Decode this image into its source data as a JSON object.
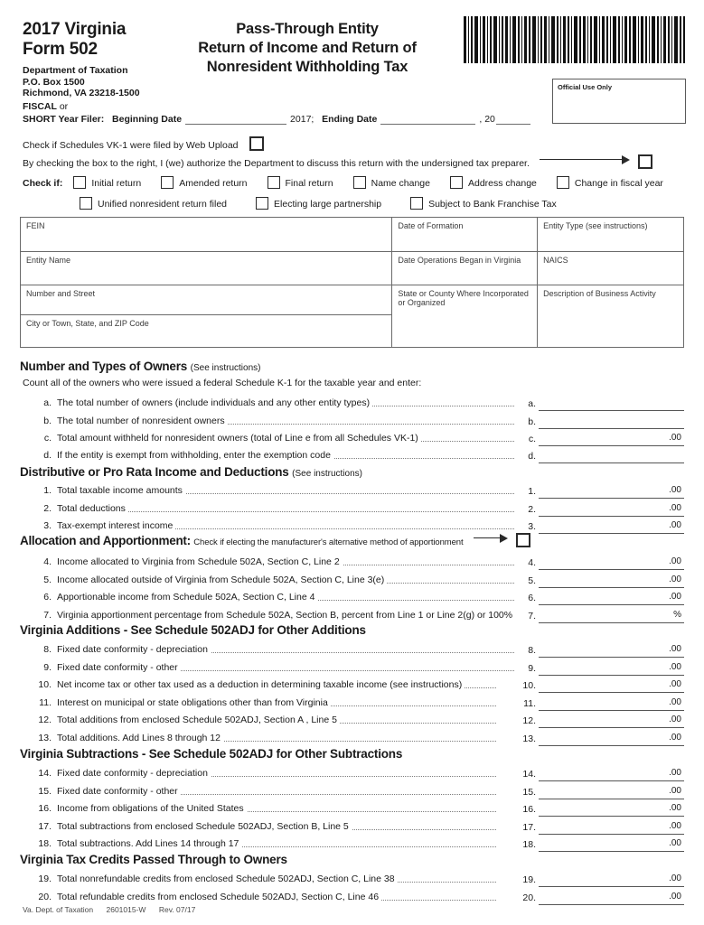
{
  "header": {
    "form_year": "2017 Virginia",
    "form_number": "Form 502",
    "dept_line1": "Department of Taxation",
    "dept_line2": "P.O. Box 1500",
    "dept_line3": "Richmond, VA 23218-1500",
    "title_line1": "Pass-Through Entity",
    "title_line2": "Return of Income and Return of",
    "title_line3": "Nonresident Withholding Tax",
    "official_use": "Official Use Only",
    "barcode_name": "barcode"
  },
  "fiscal": {
    "label_fiscal": "FISCAL",
    "label_or": " or",
    "label_short": "SHORT Year Filer:",
    "beginning_label": "Beginning Date",
    "year_mid": "2017;",
    "ending_label": "Ending Date",
    "year_suffix": ", 20"
  },
  "checks": {
    "web_upload": "Check if Schedules VK-1 were filed by Web Upload",
    "authorize": "By checking the box to the right, I (we) authorize the Department to discuss this return with the undersigned tax preparer.",
    "check_if_label": "Check if:",
    "row1": [
      "Initial return",
      "Amended return",
      "Final return",
      "Name change",
      "Address change",
      "Change in fiscal year"
    ],
    "row2": [
      "Unified nonresident return filed",
      "Electing large partnership",
      "Subject to Bank Franchise Tax"
    ]
  },
  "entity_table": {
    "rows": [
      {
        "col1": "FEIN",
        "col2": "Date of Formation",
        "col3": "Entity Type (see instructions)"
      },
      {
        "col1": "Entity Name",
        "col2": "Date Operations Began in Virginia",
        "col3": "NAICS"
      },
      {
        "col1": "Number and Street",
        "col2": "State or County Where Incorporated or Organized",
        "col3": "Description of Business Activity"
      },
      {
        "col1": "City or Town, State, and ZIP Code"
      }
    ]
  },
  "owners_section": {
    "heading": "Number and Types of Owners",
    "heading_note": "(See instructions)",
    "intro": "Count all of the owners who were issued a federal Schedule K-1 for the taxable year and enter:",
    "lines": [
      {
        "num": "a.",
        "text": "The total number of owners (include individuals and any other entity types)",
        "suffix": ""
      },
      {
        "num": "b.",
        "text": "The total number of nonresident owners",
        "suffix": ""
      },
      {
        "num": "c.",
        "text": "Total amount withheld for nonresident owners (total of Line e from all Schedules VK-1)",
        "suffix": ".00"
      },
      {
        "num": "d.",
        "text": "If the entity is exempt from withholding, enter the exemption code",
        "suffix": ""
      }
    ]
  },
  "distributive_section": {
    "heading": "Distributive or Pro Rata Income and Deductions",
    "heading_note": "(See instructions)",
    "lines": [
      {
        "num": "1.",
        "text": "Total taxable income amounts",
        "suffix": ".00"
      },
      {
        "num": "2.",
        "text": "Total deductions",
        "suffix": ".00"
      },
      {
        "num": "3.",
        "text": "Tax-exempt interest income",
        "suffix": ".00"
      }
    ]
  },
  "allocation_section": {
    "heading": "Allocation and Apportionment:",
    "checkbox_note": "Check if electing the manufacturer's alternative method of apportionment",
    "lines": [
      {
        "num": "4.",
        "text": "Income allocated to Virginia from Schedule 502A, Section C, Line 2",
        "suffix": ".00"
      },
      {
        "num": "5.",
        "text": "Income allocated outside of Virginia from Schedule 502A, Section C, Line 3(e)",
        "suffix": ".00"
      },
      {
        "num": "6.",
        "text": "Apportionable income from Schedule 502A, Section C, Line 4",
        "suffix": ".00"
      },
      {
        "num": "7.",
        "text": "Virginia apportionment percentage from Schedule 502A, Section B, percent from Line 1 or Line 2(g) or 100%",
        "suffix": "%"
      }
    ]
  },
  "additions_section": {
    "heading": "Virginia Additions - See Schedule 502ADJ for Other Additions",
    "lines": [
      {
        "num": "8.",
        "text": "Fixed date conformity - depreciation",
        "suffix": ".00"
      },
      {
        "num": "9.",
        "text": "Fixed date conformity - other",
        "suffix": ".00"
      },
      {
        "num": "10.",
        "text": "Net income tax or other tax used as a deduction in determining taxable income (see instructions)",
        "suffix": ".00"
      },
      {
        "num": "11.",
        "text": "Interest on municipal or state obligations other than from Virginia",
        "suffix": ".00"
      },
      {
        "num": "12.",
        "text": "Total additions from enclosed Schedule 502ADJ, Section A , Line 5",
        "suffix": ".00"
      },
      {
        "num": "13.",
        "text": "Total additions. Add Lines 8 through 12",
        "suffix": ".00"
      }
    ]
  },
  "subtractions_section": {
    "heading": "Virginia Subtractions - See Schedule 502ADJ for Other Subtractions",
    "lines": [
      {
        "num": "14.",
        "text": "Fixed date conformity - depreciation",
        "suffix": ".00"
      },
      {
        "num": "15.",
        "text": "Fixed date conformity - other",
        "suffix": ".00"
      },
      {
        "num": "16.",
        "text": "Income from obligations of the United States",
        "suffix": ".00"
      },
      {
        "num": "17.",
        "text": "Total subtractions from enclosed Schedule 502ADJ, Section B, Line 5",
        "suffix": ".00"
      },
      {
        "num": "18.",
        "text": "Total subtractions. Add Lines 14 through 17",
        "suffix": ".00"
      }
    ]
  },
  "credits_section": {
    "heading": "Virginia Tax Credits Passed Through to Owners",
    "lines": [
      {
        "num": "19.",
        "text": "Total nonrefundable credits from enclosed Schedule 502ADJ, Section C, Line 38",
        "suffix": ".00"
      },
      {
        "num": "20.",
        "text": "Total refundable credits from enclosed Schedule 502ADJ, Section C, Line 46",
        "suffix": ".00"
      }
    ]
  },
  "footer": {
    "agency": "Va. Dept. of Taxation",
    "form_code": "2601015-W",
    "revision": "Rev. 07/17"
  }
}
